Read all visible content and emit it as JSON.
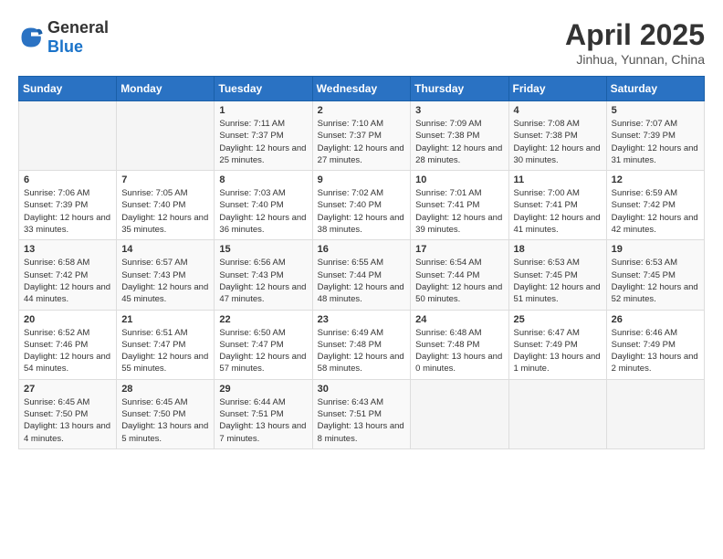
{
  "header": {
    "logo_general": "General",
    "logo_blue": "Blue",
    "month": "April 2025",
    "location": "Jinhua, Yunnan, China"
  },
  "days_of_week": [
    "Sunday",
    "Monday",
    "Tuesday",
    "Wednesday",
    "Thursday",
    "Friday",
    "Saturday"
  ],
  "weeks": [
    [
      {
        "day": "",
        "info": ""
      },
      {
        "day": "",
        "info": ""
      },
      {
        "day": "1",
        "info": "Sunrise: 7:11 AM\nSunset: 7:37 PM\nDaylight: 12 hours and 25 minutes."
      },
      {
        "day": "2",
        "info": "Sunrise: 7:10 AM\nSunset: 7:37 PM\nDaylight: 12 hours and 27 minutes."
      },
      {
        "day": "3",
        "info": "Sunrise: 7:09 AM\nSunset: 7:38 PM\nDaylight: 12 hours and 28 minutes."
      },
      {
        "day": "4",
        "info": "Sunrise: 7:08 AM\nSunset: 7:38 PM\nDaylight: 12 hours and 30 minutes."
      },
      {
        "day": "5",
        "info": "Sunrise: 7:07 AM\nSunset: 7:39 PM\nDaylight: 12 hours and 31 minutes."
      }
    ],
    [
      {
        "day": "6",
        "info": "Sunrise: 7:06 AM\nSunset: 7:39 PM\nDaylight: 12 hours and 33 minutes."
      },
      {
        "day": "7",
        "info": "Sunrise: 7:05 AM\nSunset: 7:40 PM\nDaylight: 12 hours and 35 minutes."
      },
      {
        "day": "8",
        "info": "Sunrise: 7:03 AM\nSunset: 7:40 PM\nDaylight: 12 hours and 36 minutes."
      },
      {
        "day": "9",
        "info": "Sunrise: 7:02 AM\nSunset: 7:40 PM\nDaylight: 12 hours and 38 minutes."
      },
      {
        "day": "10",
        "info": "Sunrise: 7:01 AM\nSunset: 7:41 PM\nDaylight: 12 hours and 39 minutes."
      },
      {
        "day": "11",
        "info": "Sunrise: 7:00 AM\nSunset: 7:41 PM\nDaylight: 12 hours and 41 minutes."
      },
      {
        "day": "12",
        "info": "Sunrise: 6:59 AM\nSunset: 7:42 PM\nDaylight: 12 hours and 42 minutes."
      }
    ],
    [
      {
        "day": "13",
        "info": "Sunrise: 6:58 AM\nSunset: 7:42 PM\nDaylight: 12 hours and 44 minutes."
      },
      {
        "day": "14",
        "info": "Sunrise: 6:57 AM\nSunset: 7:43 PM\nDaylight: 12 hours and 45 minutes."
      },
      {
        "day": "15",
        "info": "Sunrise: 6:56 AM\nSunset: 7:43 PM\nDaylight: 12 hours and 47 minutes."
      },
      {
        "day": "16",
        "info": "Sunrise: 6:55 AM\nSunset: 7:44 PM\nDaylight: 12 hours and 48 minutes."
      },
      {
        "day": "17",
        "info": "Sunrise: 6:54 AM\nSunset: 7:44 PM\nDaylight: 12 hours and 50 minutes."
      },
      {
        "day": "18",
        "info": "Sunrise: 6:53 AM\nSunset: 7:45 PM\nDaylight: 12 hours and 51 minutes."
      },
      {
        "day": "19",
        "info": "Sunrise: 6:53 AM\nSunset: 7:45 PM\nDaylight: 12 hours and 52 minutes."
      }
    ],
    [
      {
        "day": "20",
        "info": "Sunrise: 6:52 AM\nSunset: 7:46 PM\nDaylight: 12 hours and 54 minutes."
      },
      {
        "day": "21",
        "info": "Sunrise: 6:51 AM\nSunset: 7:47 PM\nDaylight: 12 hours and 55 minutes."
      },
      {
        "day": "22",
        "info": "Sunrise: 6:50 AM\nSunset: 7:47 PM\nDaylight: 12 hours and 57 minutes."
      },
      {
        "day": "23",
        "info": "Sunrise: 6:49 AM\nSunset: 7:48 PM\nDaylight: 12 hours and 58 minutes."
      },
      {
        "day": "24",
        "info": "Sunrise: 6:48 AM\nSunset: 7:48 PM\nDaylight: 13 hours and 0 minutes."
      },
      {
        "day": "25",
        "info": "Sunrise: 6:47 AM\nSunset: 7:49 PM\nDaylight: 13 hours and 1 minute."
      },
      {
        "day": "26",
        "info": "Sunrise: 6:46 AM\nSunset: 7:49 PM\nDaylight: 13 hours and 2 minutes."
      }
    ],
    [
      {
        "day": "27",
        "info": "Sunrise: 6:45 AM\nSunset: 7:50 PM\nDaylight: 13 hours and 4 minutes."
      },
      {
        "day": "28",
        "info": "Sunrise: 6:45 AM\nSunset: 7:50 PM\nDaylight: 13 hours and 5 minutes."
      },
      {
        "day": "29",
        "info": "Sunrise: 6:44 AM\nSunset: 7:51 PM\nDaylight: 13 hours and 7 minutes."
      },
      {
        "day": "30",
        "info": "Sunrise: 6:43 AM\nSunset: 7:51 PM\nDaylight: 13 hours and 8 minutes."
      },
      {
        "day": "",
        "info": ""
      },
      {
        "day": "",
        "info": ""
      },
      {
        "day": "",
        "info": ""
      }
    ]
  ]
}
